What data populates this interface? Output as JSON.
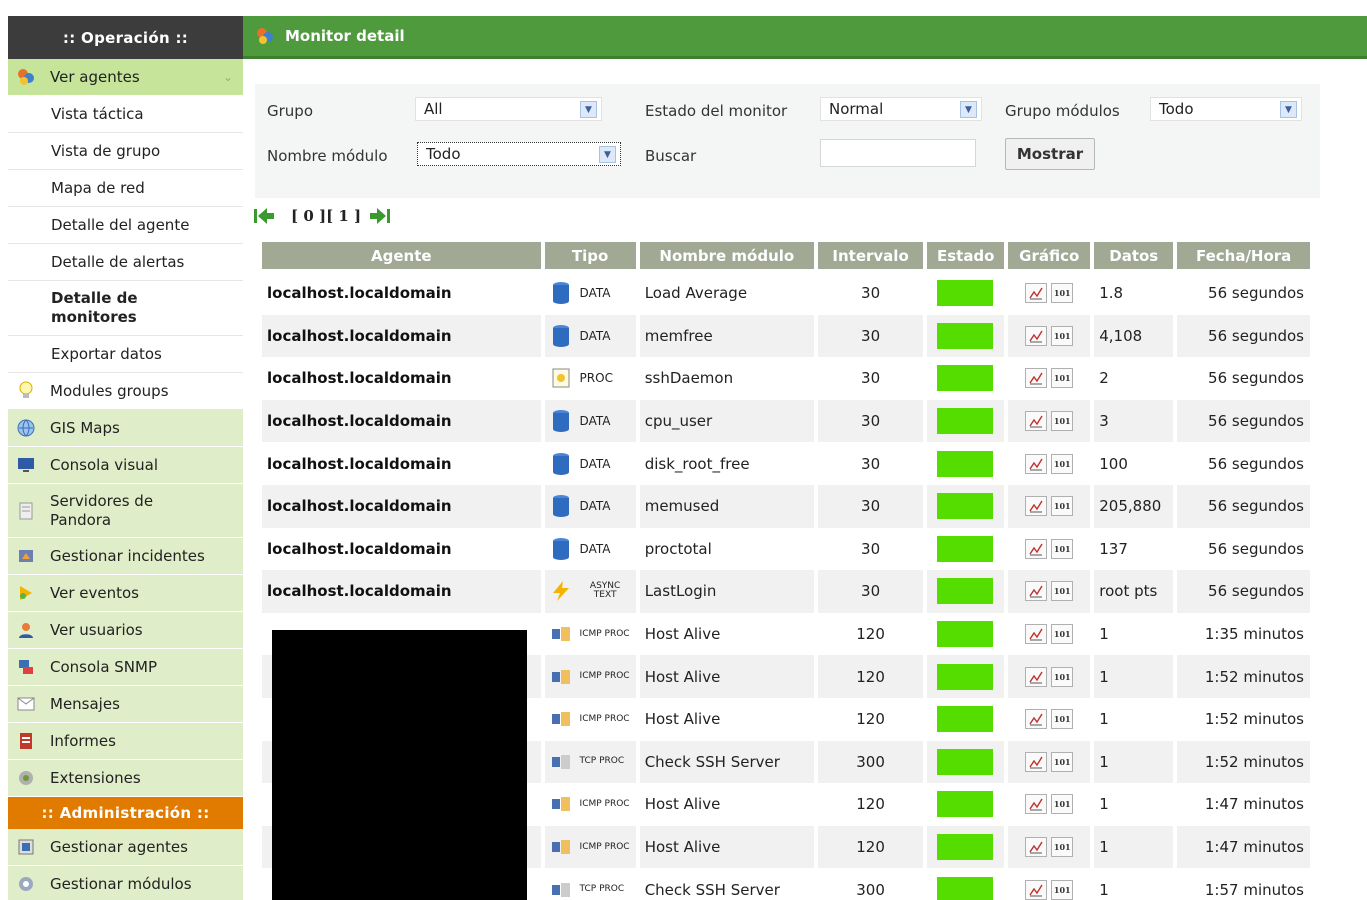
{
  "sidebar": {
    "operacion_header": ":: Operación ::",
    "ver_agentes": "Ver agentes",
    "subitems": [
      "Vista táctica",
      "Vista de grupo",
      "Mapa de red",
      "Detalle del agente",
      "Detalle de alertas"
    ],
    "active_sub_line1": "Detalle de",
    "active_sub_line2": "monitores",
    "exportar": "Exportar datos",
    "modules_groups": "Modules groups",
    "items": [
      {
        "label": "GIS Maps",
        "icon": "globe-icon"
      },
      {
        "label": "Consola visual",
        "icon": "monitor-icon"
      },
      {
        "label1": "Servidores de",
        "label2": "Pandora",
        "icon": "server-icon"
      },
      {
        "label": "Gestionar incidentes",
        "icon": "incident-icon"
      },
      {
        "label": "Ver eventos",
        "icon": "events-icon"
      },
      {
        "label": "Ver usuarios",
        "icon": "users-icon"
      },
      {
        "label": "Consola SNMP",
        "icon": "snmp-icon"
      },
      {
        "label": "Mensajes",
        "icon": "mail-icon"
      },
      {
        "label": "Informes",
        "icon": "reports-icon"
      },
      {
        "label": "Extensiones",
        "icon": "extensions-icon"
      }
    ],
    "admin_header": ":: Administración ::",
    "admin_items": [
      {
        "label": "Gestionar agentes",
        "icon": "manage-agents-icon"
      },
      {
        "label": "Gestionar módulos",
        "icon": "manage-modules-icon"
      }
    ]
  },
  "topbar": {
    "title": "Monitor detail"
  },
  "filters": {
    "grupo_label": "Grupo",
    "grupo_value": "All",
    "estado_label": "Estado del monitor",
    "estado_value": "Normal",
    "grupo_modulos_label": "Grupo módulos",
    "grupo_modulos_value": "Todo",
    "nombre_label": "Nombre módulo",
    "nombre_value": "Todo",
    "buscar_label": "Buscar",
    "buscar_value": "",
    "mostrar_button": "Mostrar"
  },
  "pager": {
    "pages": "[ 0 ][ 1 ]"
  },
  "table": {
    "headers": [
      "Agente",
      "Tipo",
      "Nombre módulo",
      "Intervalo",
      "Estado",
      "Gráfico",
      "Datos",
      "Fecha/Hora"
    ],
    "status_color": "#55dd00",
    "rows": [
      {
        "agent": "localhost.localdomain",
        "tipo_icon": "data-icon",
        "tipo": "DATA",
        "name": "Load Average",
        "interval": "30",
        "datos": "1.8",
        "fecha": "56 segundos"
      },
      {
        "agent": "localhost.localdomain",
        "tipo_icon": "data-icon",
        "tipo": "DATA",
        "name": "memfree",
        "interval": "30",
        "datos": "4,108",
        "fecha": "56 segundos"
      },
      {
        "agent": "localhost.localdomain",
        "tipo_icon": "proc-icon",
        "tipo": "PROC",
        "name": "sshDaemon",
        "interval": "30",
        "datos": "2",
        "fecha": "56 segundos"
      },
      {
        "agent": "localhost.localdomain",
        "tipo_icon": "data-icon",
        "tipo": "DATA",
        "name": "cpu_user",
        "interval": "30",
        "datos": "3",
        "fecha": "56 segundos"
      },
      {
        "agent": "localhost.localdomain",
        "tipo_icon": "data-icon",
        "tipo": "DATA",
        "name": "disk_root_free",
        "interval": "30",
        "datos": "100",
        "fecha": "56 segundos"
      },
      {
        "agent": "localhost.localdomain",
        "tipo_icon": "data-icon",
        "tipo": "DATA",
        "name": "memused",
        "interval": "30",
        "datos": "205,880",
        "fecha": "56 segundos"
      },
      {
        "agent": "localhost.localdomain",
        "tipo_icon": "data-icon",
        "tipo": "DATA",
        "name": "proctotal",
        "interval": "30",
        "datos": "137",
        "fecha": "56 segundos"
      },
      {
        "agent": "localhost.localdomain",
        "tipo_icon": "async-text-icon",
        "tipo": "ASYNC TEXT",
        "name": "LastLogin",
        "interval": "30",
        "datos": "root pts",
        "fecha": "56 segundos"
      },
      {
        "agent": "",
        "tipo_icon": "icmp-proc-icon",
        "tipo": "ICMP PROC",
        "name": "Host Alive",
        "interval": "120",
        "datos": "1",
        "fecha": "1:35 minutos"
      },
      {
        "agent": "",
        "tipo_icon": "icmp-proc-icon",
        "tipo": "ICMP PROC",
        "name": "Host Alive",
        "interval": "120",
        "datos": "1",
        "fecha": "1:52 minutos"
      },
      {
        "agent": "",
        "tipo_icon": "icmp-proc-icon",
        "tipo": "ICMP PROC",
        "name": "Host Alive",
        "interval": "120",
        "datos": "1",
        "fecha": "1:52 minutos"
      },
      {
        "agent": "",
        "tipo_icon": "tcp-proc-icon",
        "tipo": "TCP PROC",
        "name": "Check SSH Server",
        "interval": "300",
        "datos": "1",
        "fecha": "1:52 minutos"
      },
      {
        "agent": "",
        "tipo_icon": "icmp-proc-icon",
        "tipo": "ICMP PROC",
        "name": "Host Alive",
        "interval": "120",
        "datos": "1",
        "fecha": "1:47 minutos"
      },
      {
        "agent": "",
        "tipo_icon": "icmp-proc-icon",
        "tipo": "ICMP PROC",
        "name": "Host Alive",
        "interval": "120",
        "datos": "1",
        "fecha": "1:47 minutos"
      },
      {
        "agent": "",
        "tipo_icon": "tcp-proc-icon",
        "tipo": "TCP PROC",
        "name": "Check SSH Server",
        "interval": "300",
        "datos": "1",
        "fecha": "1:57 minutos"
      }
    ]
  }
}
